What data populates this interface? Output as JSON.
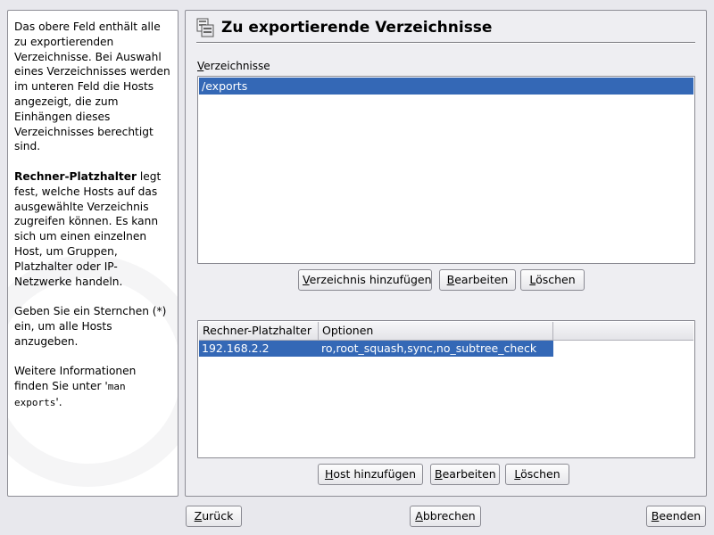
{
  "help": {
    "p1": "Das obere Feld enthält alle zu exportierenden Verzeichnisse. Bei Auswahl eines Verzeichnisses werden im unteren Feld die Hosts angezeigt, die zum Einhängen dieses Verzeichnisses berechtigt sind.",
    "p2_bold": "Rechner-Platzhalter",
    "p2_rest": " legt fest, welche Hosts auf das ausgewählte Verzeichnis zugreifen können. Es kann sich um einen einzelnen Host, um Gruppen, Platzhalter oder IP-Netzwerke handeln.",
    "p3": "Geben Sie ein Sternchen (*) ein, um alle Hosts anzugeben.",
    "p4_pre": "Weitere Informationen finden Sie unter '",
    "p4_code": "man exports",
    "p4_post": "'."
  },
  "main": {
    "title": "Zu exportierende Verzeichnisse",
    "dirs_label_first": "V",
    "dirs_label_rest": "erzeichnisse",
    "directories": [
      "/exports"
    ],
    "dir_buttons": {
      "add_u": "V",
      "add_rest": "erzeichnis hinzufügen",
      "edit_u": "B",
      "edit_rest": "earbeiten",
      "delete_u": "L",
      "delete_rest": "öschen"
    },
    "hosts_table": {
      "columns": [
        "Rechner-Platzhalter",
        "Optionen"
      ],
      "rows": [
        {
          "host": "192.168.2.2",
          "options": "ro,root_squash,sync,no_subtree_check"
        }
      ]
    },
    "host_buttons": {
      "add_u": "H",
      "add_rest": "ost hinzufügen",
      "edit_u": "B",
      "edit_rest": "earbeiten",
      "delete_u": "L",
      "delete_rest": "öschen"
    }
  },
  "footer": {
    "back_u": "Z",
    "back_rest": "urück",
    "cancel_u": "A",
    "cancel_rest": "bbrechen",
    "finish_u": "B",
    "finish_rest": "eenden"
  },
  "colors": {
    "selection": "#3468b6",
    "window_bg": "#e8e8ed"
  }
}
